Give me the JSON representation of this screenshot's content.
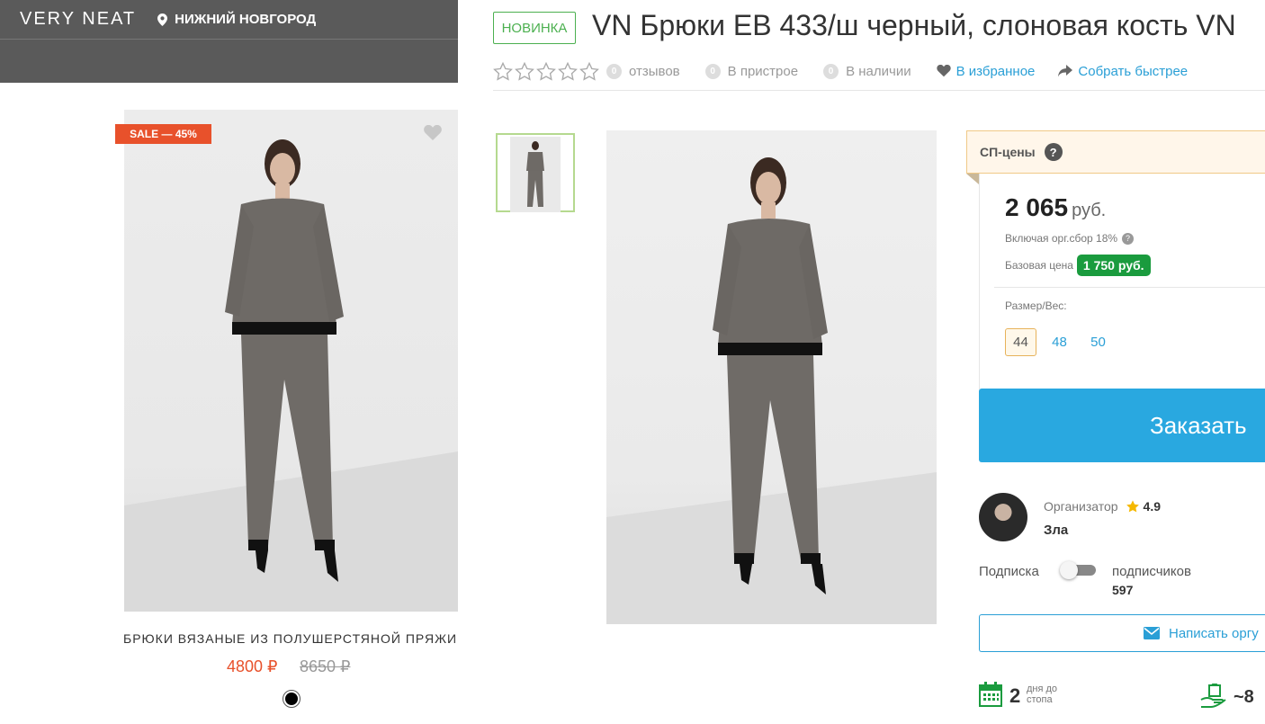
{
  "store": {
    "brand": "VERY NEAT",
    "city": "НИЖНИЙ НОВГОРОД",
    "card": {
      "sale_badge": "SALE — 45%",
      "title": "БРЮКИ ВЯЗАНЫЕ ИЗ ПОЛУШЕРСТЯНОЙ ПРЯЖИ",
      "price": "4800 ₽",
      "old_price": "8650 ₽",
      "color": "#000000"
    }
  },
  "product": {
    "badge": "НОВИНКА",
    "title": "VN Брюки EB 433/ш черный, слоновая кость VN",
    "reviews_count": "0",
    "reviews_label": "отзывов",
    "pristroy_count": "0",
    "pristroy_label": "В пристрое",
    "stock_count": "0",
    "stock_label": "В наличии",
    "favorite_label": "В избранное",
    "share_label": "Собрать быстрее"
  },
  "pricing": {
    "header": "СП-цены",
    "help": "?",
    "price": "2 065",
    "currency": "руб.",
    "fee_note": "Включая орг.сбор 18%",
    "base_label": "Базовая цена",
    "base_price": "1 750 руб.",
    "size_label": "Размер/Вес:",
    "sizes": [
      "44",
      "48",
      "50"
    ],
    "selected_size": "44",
    "order_button": "Заказать"
  },
  "organizer": {
    "label": "Организатор",
    "rating": "4.9",
    "name": "Зла",
    "subscribe_label": "Подписка",
    "subscribers_label": "подписчиков",
    "subscribers_count": "597",
    "write_button": "Написать оргу"
  },
  "stats": {
    "days": "2",
    "days_text": "дня до стопа",
    "approx": "~8"
  },
  "colors": {
    "accent_blue": "#29a8e0",
    "sale_red": "#e8512b",
    "green": "#1a9b3e",
    "header_gray": "#5a5a5a"
  }
}
